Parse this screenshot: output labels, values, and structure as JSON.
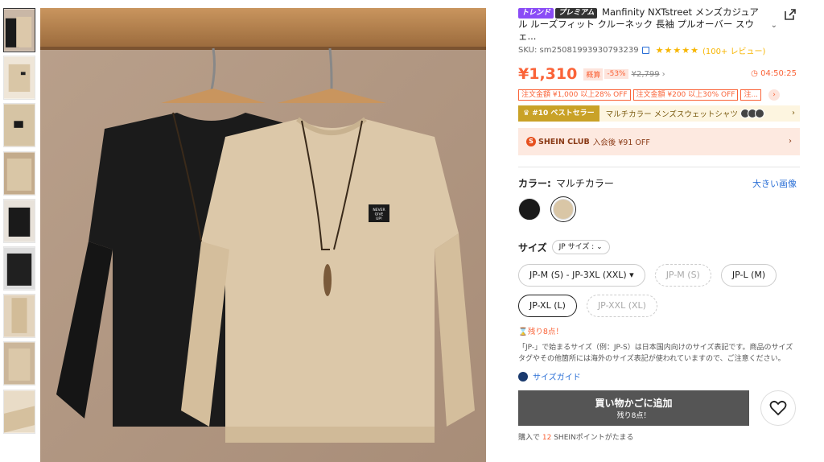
{
  "gallery": {
    "thumbnails": [
      {
        "label": "black and beige sweatshirts",
        "active": true
      },
      {
        "label": "beige sweatshirt front"
      },
      {
        "label": "black label patch"
      },
      {
        "label": "beige folded"
      },
      {
        "label": "black sweatshirt"
      },
      {
        "label": "black sweatshirt flat"
      },
      {
        "label": "beige sleeve detail"
      },
      {
        "label": "beige sweatshirt"
      },
      {
        "label": "beige cuff detail"
      }
    ],
    "main_image_patch_text": [
      "NEVER",
      "GIVE",
      "UP!"
    ]
  },
  "product": {
    "badge_trend": "トレンド",
    "badge_premium": "プレミアム",
    "title": "Manfinity NXTstreet メンズカジュアル ルーズフィット クルーネック 長袖 プルオーバー スウェ...",
    "sku_label": "SKU: sm2508199393079323​9",
    "stars": "★★★★★",
    "reviews": "(100+ レビュー)"
  },
  "pricing": {
    "price": "¥1,310",
    "est_label": "概算",
    "discount": "-53%",
    "original_price": "¥2,799",
    "timer": "04:50:25"
  },
  "coupons": [
    "注文金額 ¥1,000 以上28% OFF",
    "注文金額 ¥200 以上30% OFF",
    "注..."
  ],
  "bestseller": {
    "tag": "#10 ベストセラー",
    "category": "マルチカラー メンズスウェットシャツ"
  },
  "club": {
    "name": "SHEIN CLUB",
    "text": "入会後 ¥91 OFF"
  },
  "color": {
    "label": "カラー:",
    "value": "マルチカラー",
    "big_image_link": "大きい画像",
    "swatches": [
      {
        "name": "black",
        "hex": "#1a1a1a"
      },
      {
        "name": "beige",
        "hex": "#d9c6a6",
        "selected": true
      }
    ]
  },
  "size": {
    "label": "サイズ",
    "select_label": "JP サイズ :",
    "options": [
      {
        "label": "JP-M (S) - JP-3XL (XXL) ▾",
        "state": "normal"
      },
      {
        "label": "JP-M (S)",
        "state": "disabled"
      },
      {
        "label": "JP-L (M)",
        "state": "normal"
      },
      {
        "label": "JP-XL (L)",
        "state": "selected"
      },
      {
        "label": "JP-XXL (XL)",
        "state": "disabled"
      }
    ],
    "stock_warning": "残り8点！",
    "note": "「JP-」で始まるサイズ（例：JP-S）は日本国内向けのサイズ表記です。商品のサイズタグやその他箇所には海外のサイズ表記が使われていますので、ご注意ください。",
    "guide": "サイズガイド"
  },
  "cart": {
    "button_label": "買い物かごに追加",
    "button_sub": "残り8点！",
    "points_prefix": "購入で",
    "points_value": "12",
    "points_suffix": "SHEINポイントがたまる"
  },
  "colors": {
    "accent": "#fa6338",
    "link": "#2a6fd6",
    "cart_button": "#555555"
  }
}
